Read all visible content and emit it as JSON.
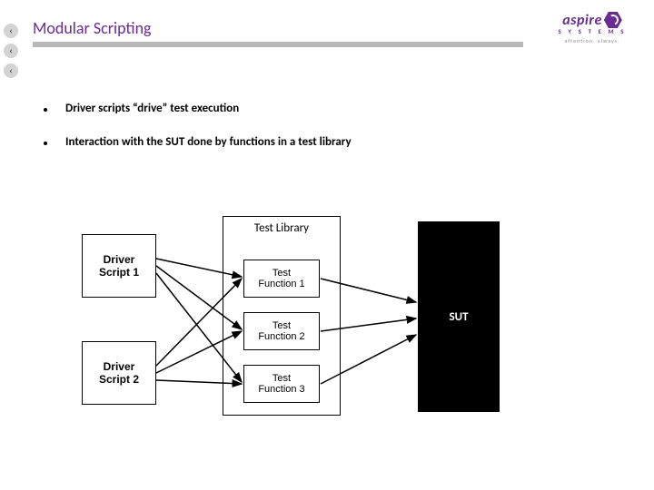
{
  "title": "Modular Scripting",
  "logo": {
    "wordmark": "aspire",
    "subline": "S Y S T E M S",
    "tagline": "attention. always."
  },
  "bullets": [
    "Driver scripts “drive” test execution",
    "Interaction with the SUT done by functions in a test library"
  ],
  "diagram": {
    "driver1": "Driver\nScript 1",
    "driver2": "Driver\nScript 2",
    "library_title": "Test Library",
    "funcs": [
      "Test\nFunction 1",
      "Test\nFunction 2",
      "Test\nFunction 3"
    ],
    "sut": "SUT"
  },
  "nav_glyphs": [
    "‹",
    "‹",
    "‹"
  ]
}
